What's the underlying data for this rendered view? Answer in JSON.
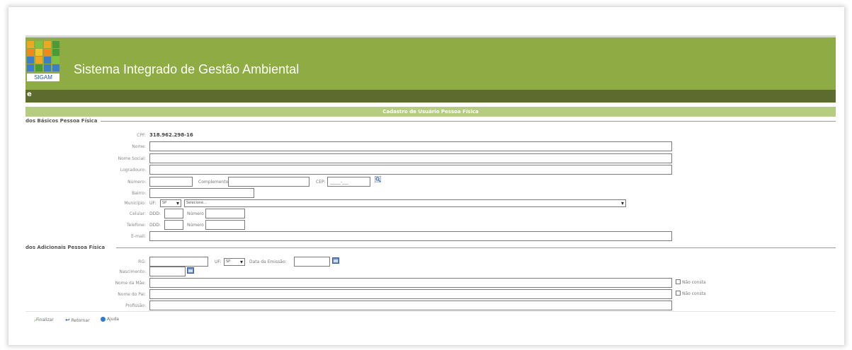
{
  "app": {
    "title": "Sistema Integrado de Gestão Ambiental",
    "logo_text": "SIGAM"
  },
  "nav": {
    "glyph": "e"
  },
  "form": {
    "title": "Cadastro de Usuário Pessoa Física",
    "section1": {
      "legend": "dos Básicos Pessoa Física",
      "cpf_label": "CPF:",
      "cpf_value": "318.962.298-16",
      "nome_label": "Nome:",
      "nome_social_label": "Nome Social:",
      "logradouro_label": "Logradouro:",
      "numero_label": "Número:",
      "complemento_label": "Complemento:",
      "cep_label": "CEP:",
      "cep_placeholder": "_____-___",
      "bairro_label": "Bairro:",
      "municipio_label": "Município:",
      "uf_label": "UF:",
      "uf_value": "SP",
      "municipio_value": "Selecione...",
      "celular_label": "Celular:",
      "ddd_label": "DDD:",
      "numero2_label": "Número",
      "telefone_label": "Telefone:",
      "email_label": "E-mail:"
    },
    "section2": {
      "legend": "dos Adicionais Pessoa Física",
      "rg_label": "RG:",
      "uf_label": "UF:",
      "uf_value": "SP",
      "data_emissao_label": "Data da Emissão:",
      "nascimento_label": "Nascimento:",
      "nome_mae_label": "Nome da Mãe:",
      "nome_pai_label": "Nome do Pai:",
      "profissao_label": "Profissão:",
      "nao_consta_label": "Não consta"
    }
  },
  "actions": {
    "finalizar": "Finalizar",
    "retornar": "Retornar",
    "ajuda": "Ajuda"
  },
  "colors": {
    "header_green": "#8fac44",
    "nav_dark": "#5e6b2e",
    "title_bar": "#b6cc80"
  }
}
